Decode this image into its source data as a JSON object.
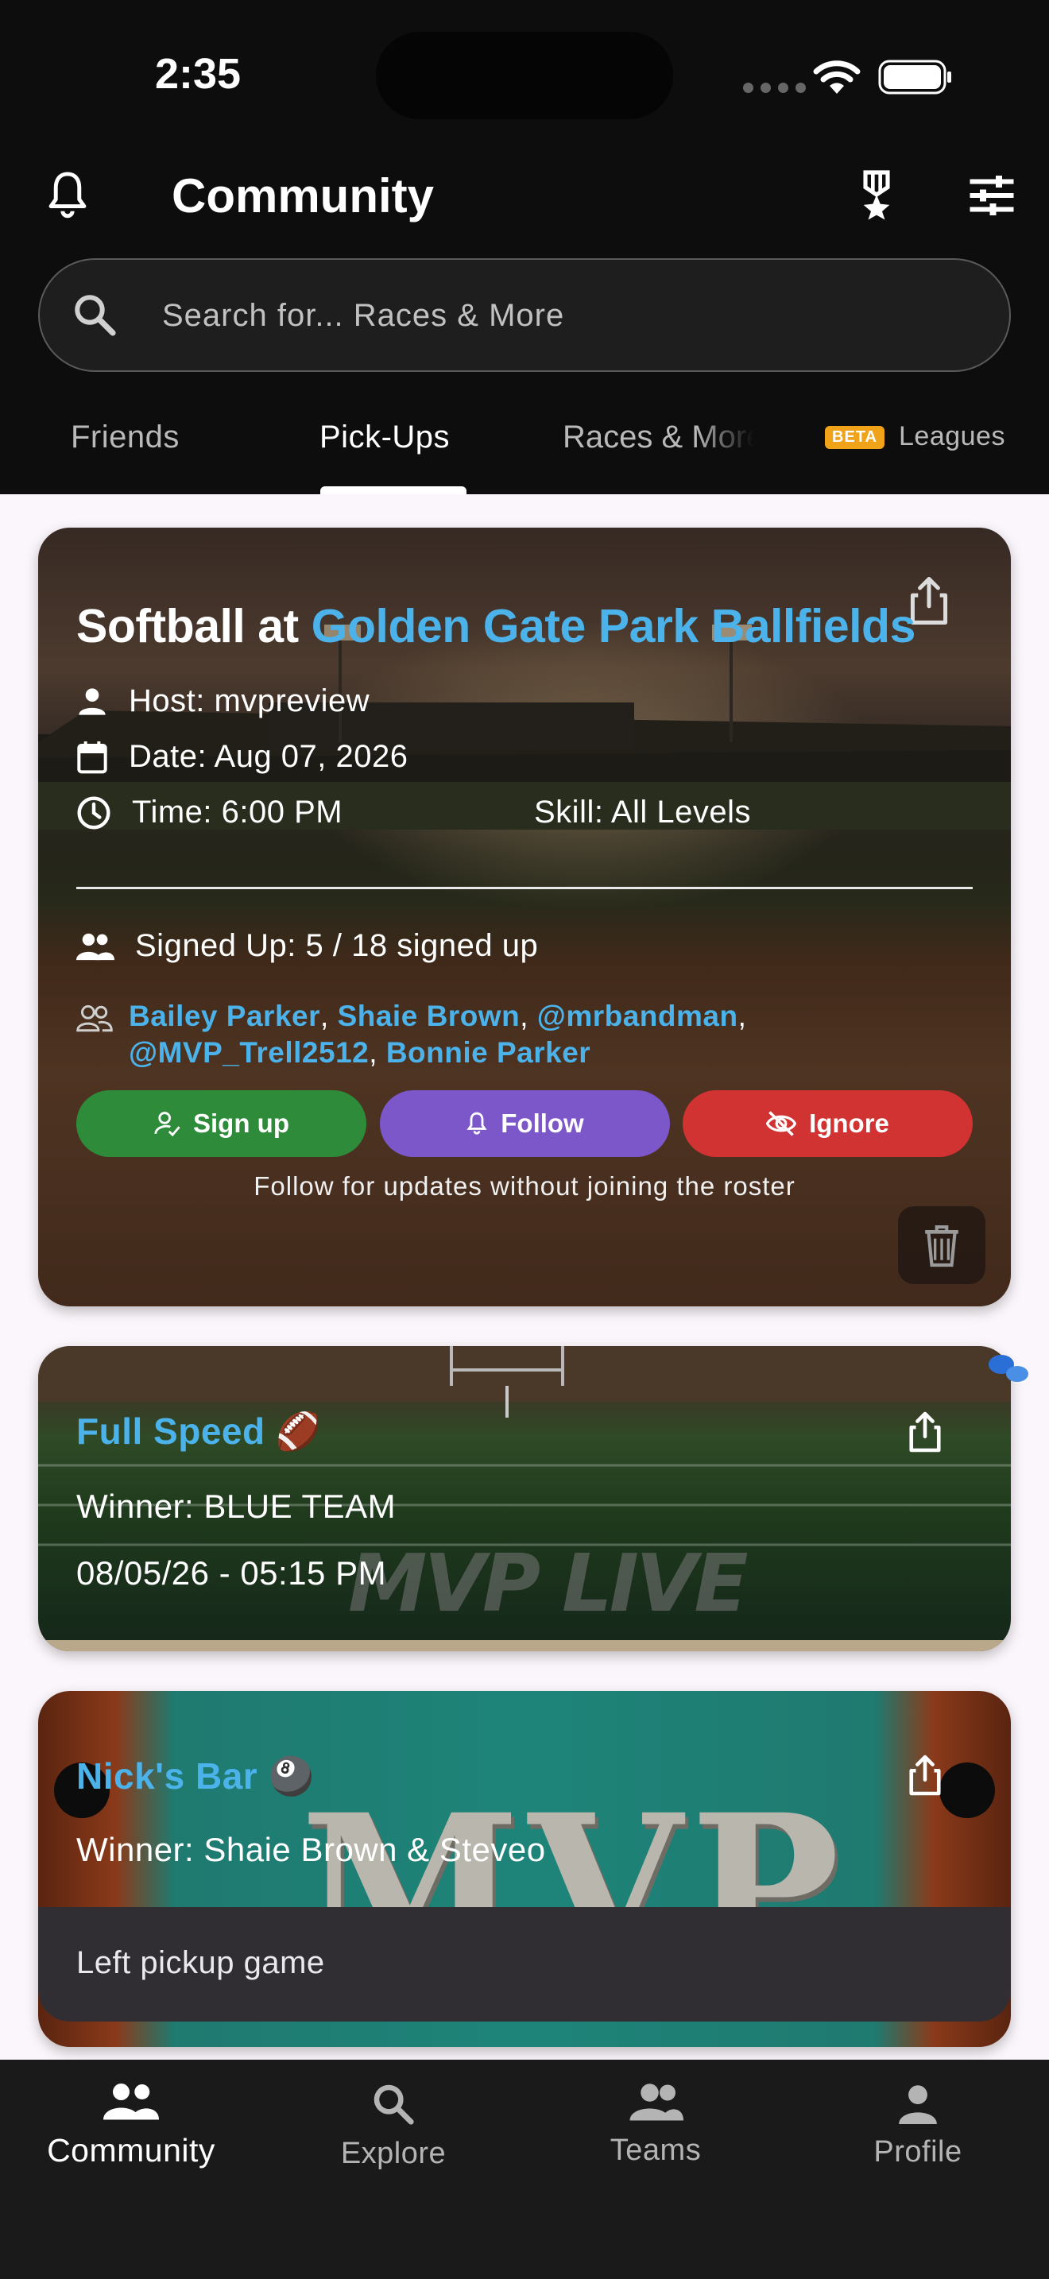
{
  "status_bar": {
    "time": "2:35"
  },
  "header": {
    "title": "Community"
  },
  "search": {
    "placeholder": "Search for... Races & More"
  },
  "tabs": {
    "friends": "Friends",
    "pickups": "Pick-Ups",
    "races": "Races & More",
    "beta_badge": "BETA",
    "leagues": "Leagues",
    "active": "Pick-Ups"
  },
  "pickup_card": {
    "title_prefix": "Softball at",
    "location": "Golden Gate Park Ballfields",
    "host": "Host: mvpreview",
    "date": "Date: Aug 07, 2026",
    "time": "Time: 6:00 PM",
    "skill": "Skill: All Levels",
    "signed_up": "Signed Up: 5 / 18 signed up",
    "players": [
      "Bailey Parker",
      "Shaie Brown",
      "@mrbandman",
      "@MVP_Trell2512",
      "Bonnie Parker"
    ],
    "buttons": {
      "signup": "Sign up",
      "follow": "Follow",
      "ignore": "Ignore"
    },
    "hint": "Follow for updates without joining the roster"
  },
  "result_card_1": {
    "title": "Full Speed 🏈",
    "winner": "Winner: BLUE TEAM",
    "datetime": "08/05/26 - 05:15 PM",
    "logo_text": "MVP LIVE"
  },
  "result_card_2": {
    "title": "Nick's Bar 🎱",
    "winner": "Winner: Shaie Brown & Steveo",
    "logo_text": "MVP"
  },
  "snackbar": {
    "message": "Left pickup game"
  },
  "bottom_nav": {
    "community": "Community",
    "explore": "Explore",
    "teams": "Teams",
    "profile": "Profile",
    "active": "Community"
  },
  "colors": {
    "accent_blue": "#4bb2ea",
    "signup_green": "#2e8b3a",
    "follow_purple": "#7c57c9",
    "ignore_red": "#d13232",
    "beta_orange": "#f0a218"
  }
}
